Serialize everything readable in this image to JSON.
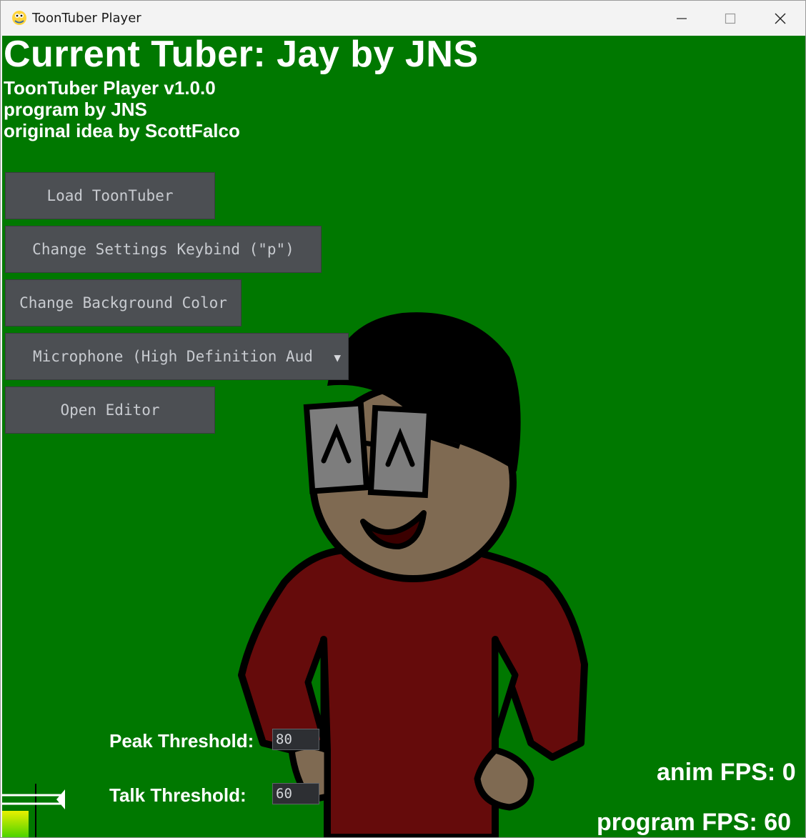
{
  "window": {
    "title": "ToonTuber Player",
    "icon": "python-snake-icon"
  },
  "header": {
    "current_tuber": "Current Tuber: Jay by JNS",
    "version": "ToonTuber Player v1.0.0",
    "program_by": "program by JNS",
    "original_idea": "original idea by ScottFalco"
  },
  "buttons": {
    "load": "Load ToonTuber",
    "keybind": "Change Settings Keybind (\"p\")",
    "background": "Change Background Color",
    "microphone": "Microphone (High Definition Aud",
    "editor": "Open Editor"
  },
  "thresholds": {
    "peak_label": "Peak Threshold:",
    "peak_value": "80",
    "talk_label": "Talk Threshold:",
    "talk_value": "60"
  },
  "stats": {
    "anim_fps": "anim FPS: 0",
    "program_fps": "program FPS: 60"
  },
  "colors": {
    "background": "#007800",
    "button": "#4c4f53",
    "shirt": "#650b0b",
    "skin": "#7f6a52"
  }
}
